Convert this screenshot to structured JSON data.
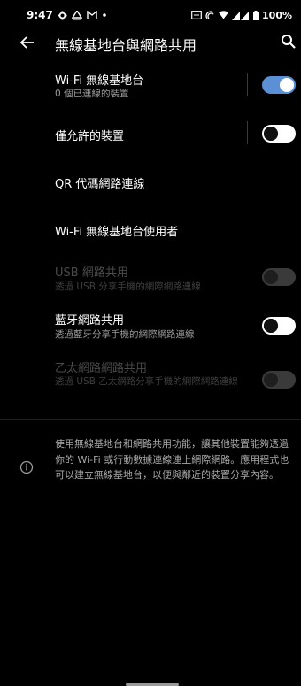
{
  "status_bar": {
    "time": "9:47",
    "battery": "100%",
    "icons_left": [
      "gear-icon",
      "vpn-icon",
      "mail-icon",
      "dot-icon"
    ],
    "icons_right": [
      "cast-icon",
      "nfc-icon",
      "wifi-icon",
      "signal-icon",
      "battery-icon"
    ]
  },
  "app_bar": {
    "title": "無線基地台與網路共用"
  },
  "settings": {
    "hotspot": {
      "title": "Wi-Fi 無線基地台",
      "subtitle": "0 個已連線的裝置",
      "enabled": true
    },
    "allowed_devices": {
      "title": "僅允許的裝置",
      "enabled": false
    },
    "qr_code": {
      "title": "QR 代碼網路連線"
    },
    "hotspot_users": {
      "title": "Wi-Fi 無線基地台使用者"
    },
    "usb_tethering": {
      "title": "USB 網路共用",
      "subtitle": "透過 USB 分享手機的網際網路連線",
      "enabled": false,
      "disabled": true
    },
    "bluetooth_tethering": {
      "title": "藍牙網路共用",
      "subtitle": "透過藍牙分享手機的網際網路連線",
      "enabled": false
    },
    "ethernet_tethering": {
      "title": "乙太網路網路共用",
      "subtitle": "透過 USB 乙太網路分享手機的網際網路連線",
      "enabled": false,
      "disabled": true
    }
  },
  "info": {
    "text": "使用無線基地台和網路共用功能，讓其他裝置能夠透過你的 Wi-Fi 或行動數據連線連上網際網路。應用程式也可以建立無線基地台，以便與鄰近的裝置分享內容。"
  },
  "colors": {
    "background": "#000000",
    "accent": "#5b8fd6",
    "secondary_text": "#9a9a9a",
    "disabled_text": "#4a4a4a"
  }
}
